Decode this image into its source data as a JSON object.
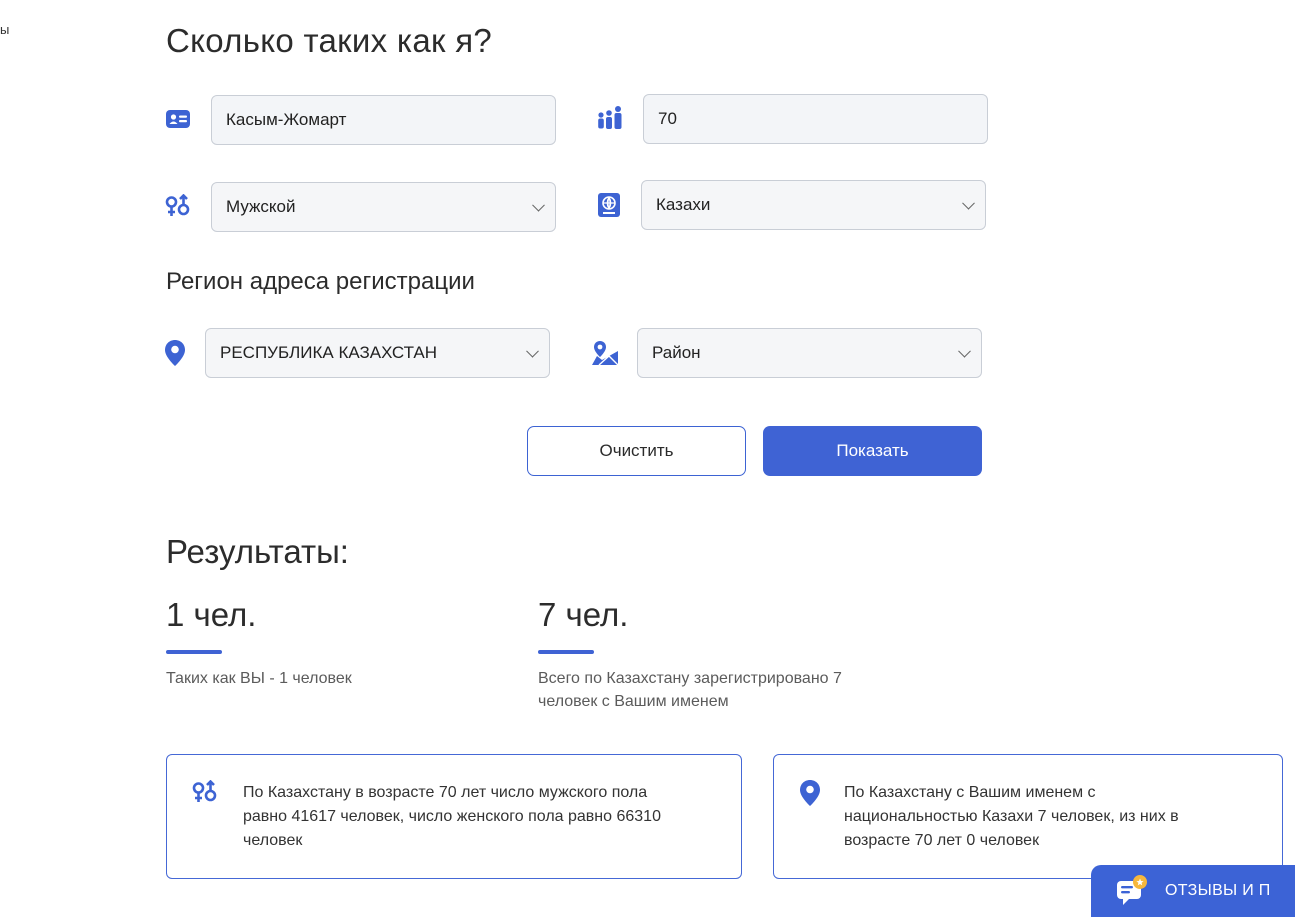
{
  "edge_label": "ы",
  "title": "Сколько таких как я?",
  "form": {
    "name_value": "Касым-Жомарт",
    "age_value": "70",
    "gender_value": "Мужской",
    "nationality_value": "Казахи",
    "region_section_title": "Регион адреса регистрации",
    "region_value": "РЕСПУБЛИКА КАЗАХСТАН",
    "district_value": "Район",
    "clear_label": "Очистить",
    "show_label": "Показать"
  },
  "results": {
    "title": "Результаты:",
    "same_count": "1 чел.",
    "same_note": "Таких как ВЫ - 1 человек",
    "name_count": "7 чел.",
    "name_note_line1": "Всего по Казахстану зарегистрировано 7",
    "name_note_line2": "человек с Вашим именем"
  },
  "cards": {
    "gender_line1": "По Казахстану в возрасте 70 лет число мужского пола",
    "gender_line2": "равно 41617 человек, число женского пола равно 66310",
    "gender_line3": "человек",
    "nation_line1": "По Казахстану с Вашим именем с",
    "nation_line2": "национальностью Казахи 7 человек, из них в",
    "nation_line3": "возрасте 70 лет 0 человек"
  },
  "feedback": {
    "label": "ОТЗЫВЫ И П"
  },
  "colors": {
    "accent": "#3f63d4",
    "field_bg": "#f3f5f8",
    "border": "#c9ced6"
  },
  "icons": {
    "name": "id-card-icon",
    "age": "people-icon",
    "gender": "gender-icon",
    "nationality": "passport-icon",
    "region": "map-pin-icon",
    "district": "map-icon",
    "feedback": "chat-icon"
  }
}
